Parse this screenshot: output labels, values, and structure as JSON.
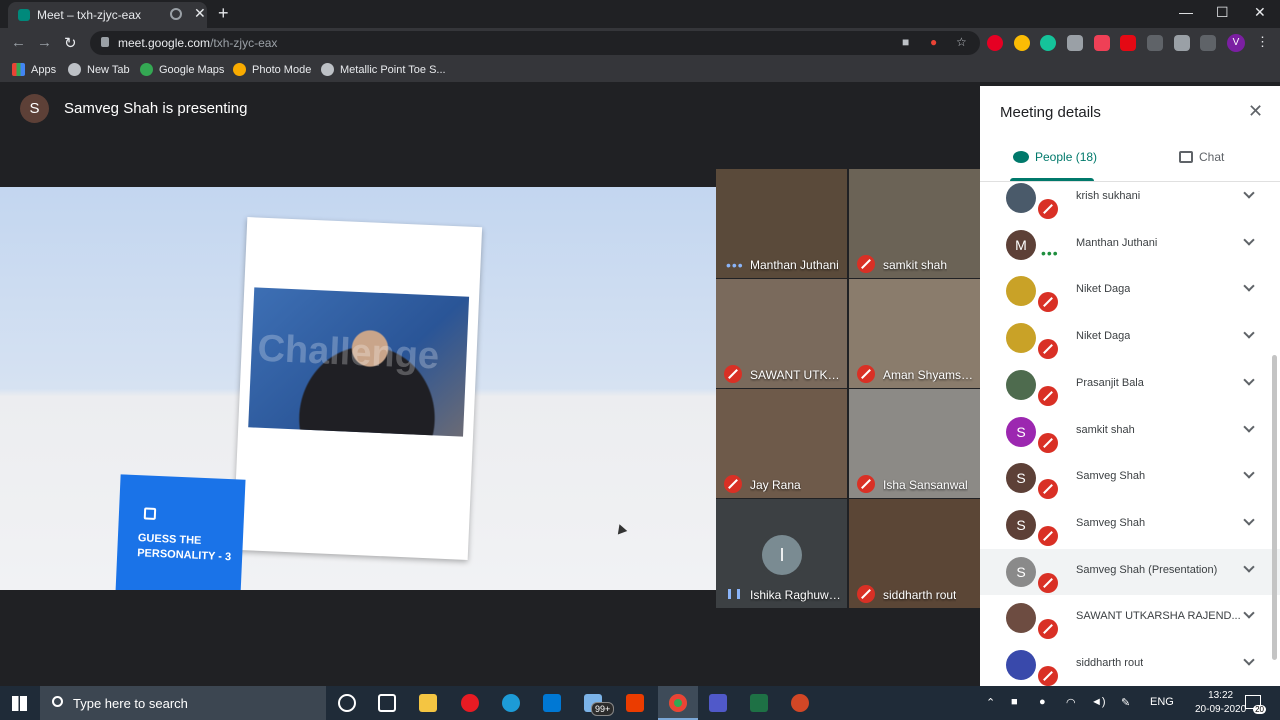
{
  "browser": {
    "tab_title": "Meet – txh-zjyc-eax",
    "url_domain": "meet.google.com",
    "url_path": "/txh-zjyc-eax",
    "bookmarks": [
      "Apps",
      "New Tab",
      "Google Maps",
      "Photo Mode",
      "Metallic Point Toe S..."
    ],
    "profile_initial": "V"
  },
  "meeting": {
    "presenter_initial": "S",
    "presenting_text": "Samveg Shah is presenting",
    "slide_text": "GUESS THE PERSONALITY - 3",
    "slide_watermark": "Challenge",
    "tiles": [
      {
        "name": "Manthan Juthani",
        "status": "speaking-dots",
        "bg": "#5a4a3a"
      },
      {
        "name": "samkit shah",
        "status": "muted",
        "bg": "#6b6356"
      },
      {
        "name": "SAWANT UTKAR...",
        "status": "muted",
        "bg": "#7a6a5c"
      },
      {
        "name": "Aman Shyamsuk...",
        "status": "muted",
        "bg": "#8a7c6c"
      },
      {
        "name": "Jay Rana",
        "status": "muted",
        "bg": "#6e5a4a"
      },
      {
        "name": "Isha Sansanwal",
        "status": "muted",
        "bg": "#8c8a86"
      },
      {
        "name": "Ishika Raghuwan...",
        "status": "speaking-bars",
        "bg": "#3c4043",
        "initial": "I"
      },
      {
        "name": "siddharth rout",
        "status": "muted",
        "bg": "#5b4636"
      }
    ]
  },
  "panel": {
    "title": "Meeting details",
    "people_tab": "People (18)",
    "chat_tab": "Chat",
    "people": [
      {
        "name": "krish sukhani",
        "initial": "",
        "color": "#4a5a6a"
      },
      {
        "name": "Manthan Juthani",
        "initial": "M",
        "color": "#5d4037",
        "status": "dots"
      },
      {
        "name": "Niket Daga",
        "initial": "",
        "color": "#c9a227"
      },
      {
        "name": "Niket Daga",
        "initial": "",
        "color": "#c9a227"
      },
      {
        "name": "Prasanjit Bala",
        "initial": "",
        "color": "#4e6b4e"
      },
      {
        "name": "samkit shah",
        "initial": "S",
        "color": "#9c27b0"
      },
      {
        "name": "Samveg Shah",
        "initial": "S",
        "color": "#5d4037"
      },
      {
        "name": "Samveg Shah",
        "initial": "S",
        "color": "#5d4037"
      },
      {
        "name": "Samveg Shah (Presentation)",
        "initial": "S",
        "color": "#8a8a8a",
        "highlight": true
      },
      {
        "name": "SAWANT UTKARSHA RAJEND...",
        "initial": "",
        "color": "#6d4c41"
      },
      {
        "name": "siddharth rout",
        "initial": "",
        "color": "#3949ab"
      }
    ]
  },
  "taskbar": {
    "search_placeholder": "Type here to search",
    "mail_badge": "99+",
    "language": "ENG",
    "time": "13:22",
    "date": "20-09-2020",
    "notifications": "20"
  },
  "colors": {
    "meet_teal": "#00796b",
    "muted_red": "#d93025",
    "slide_blue": "#1a73e8"
  }
}
